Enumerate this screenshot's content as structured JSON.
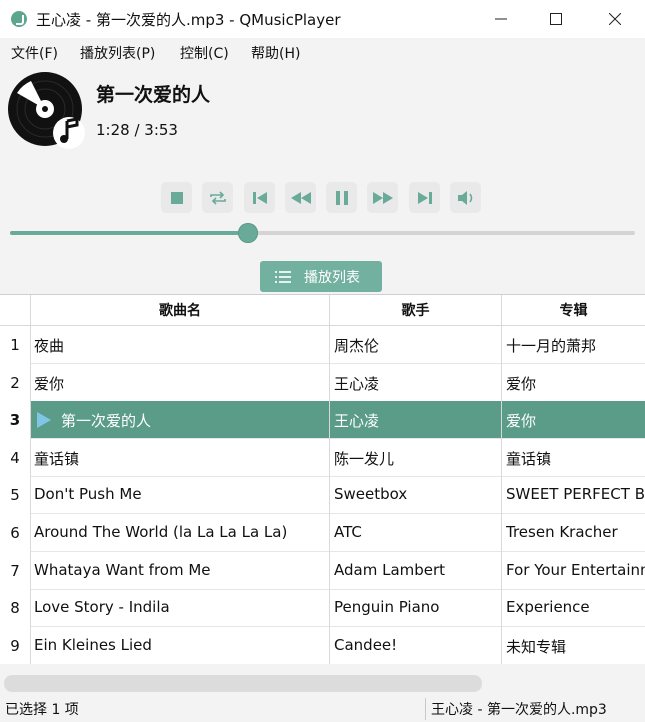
{
  "window": {
    "title": "王心凌 - 第一次爱的人.mp3 - QMusicPlayer"
  },
  "menu": [
    "文件(F)",
    "播放列表(P)",
    "控制(C)",
    "帮助(H)"
  ],
  "now_playing": {
    "title": "第一次爱的人",
    "time": "1:28 / 3:53",
    "progress": 0.38
  },
  "controls": [
    "stop",
    "repeat",
    "previous",
    "rewind",
    "pause",
    "fast-forward",
    "next",
    "volume"
  ],
  "playlist_button": "播放列表",
  "table": {
    "headers": [
      "歌曲名",
      "歌手",
      "专辑"
    ],
    "selected_row": 3,
    "rows": [
      {
        "num": "1",
        "title": "夜曲",
        "artist": "周杰伦",
        "album": "十一月的萧邦"
      },
      {
        "num": "2",
        "title": "爱你",
        "artist": "王心凌",
        "album": "爱你"
      },
      {
        "num": "3",
        "title": "第一次爱的人",
        "artist": "王心凌",
        "album": "爱你"
      },
      {
        "num": "4",
        "title": "童话镇",
        "artist": "陈一发儿",
        "album": "童话镇"
      },
      {
        "num": "5",
        "title": "Don't Push Me",
        "artist": "Sweetbox",
        "album": "SWEET PERFECT BO"
      },
      {
        "num": "6",
        "title": "Around The World (la La La La La)",
        "artist": "ATC",
        "album": "Tresen Kracher"
      },
      {
        "num": "7",
        "title": "Whataya Want from Me",
        "artist": "Adam Lambert",
        "album": "For Your Entertainn"
      },
      {
        "num": "8",
        "title": "Love Story - Indila",
        "artist": "Penguin Piano",
        "album": "Experience"
      },
      {
        "num": "9",
        "title": "Ein Kleines Lied",
        "artist": "Candee!",
        "album": "未知专辑"
      }
    ]
  },
  "status": {
    "left": "已选择 1 项",
    "right": "王心凌 - 第一次爱的人.mp3"
  },
  "colors": {
    "accent": "#6aaa98",
    "selected_row": "#5a9c88",
    "background": "#f3f3f3"
  }
}
